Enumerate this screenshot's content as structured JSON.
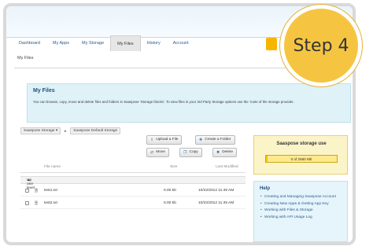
{
  "nav": {
    "items": [
      "Dashboard",
      "My Apps",
      "My Storage",
      "My Files",
      "History",
      "Account"
    ],
    "active": "My Files"
  },
  "page": {
    "label": "My Files"
  },
  "info": {
    "title": "My Files",
    "text": "You can browse, copy, move and delete files and folders in Saaspose 'Storage blocks'. To view files in your 3rd Party Storage options use the 'roots of the storage provider."
  },
  "breadcrumb": {
    "storage_select": "Saaspose Storage",
    "location": "Saaspose Default Storage"
  },
  "toolbar": {
    "upload": "Upload a File",
    "create_folder": "Create a Folder",
    "move": "Move",
    "copy": "Copy",
    "delete": "Delete"
  },
  "table": {
    "headers": {
      "name": "File name",
      "size": "Size",
      "modified": "Last Modified"
    },
    "up_level": "Up one level",
    "rows": [
      {
        "name": "test1.txt",
        "size": "0.00 kb",
        "modified": "10/22/2012 11:45 AM"
      },
      {
        "name": "test2.txt",
        "size": "0.00 kb",
        "modified": "10/22/2012 11:45 AM"
      }
    ]
  },
  "storage": {
    "title": "Saaspose storage use",
    "usage_text": "0 of 2560 Mb",
    "fill_fraction": 0.02
  },
  "help": {
    "title": "Help",
    "links": [
      "Creating and Managing Saaspose Account",
      "Creating New Apps & Getting App Key",
      "Working with Files & Storage",
      "Working with API Usage Log"
    ]
  },
  "step": {
    "label": "Step 4"
  },
  "colors": {
    "accent": "#f5c542",
    "info_bg": "#dff2f8",
    "storage_bg": "#fcf4c9",
    "link": "#2a5b8f"
  }
}
